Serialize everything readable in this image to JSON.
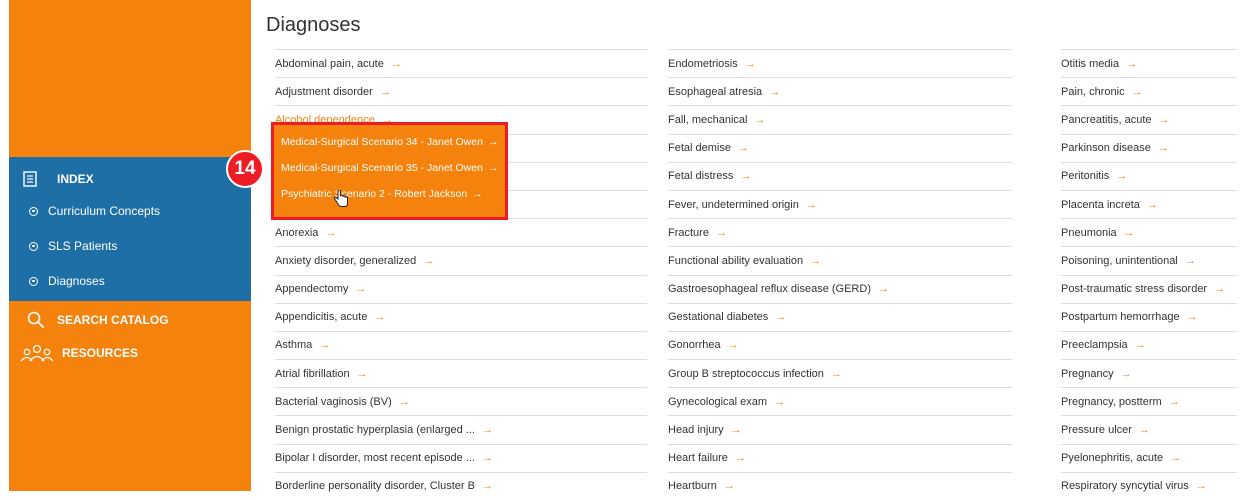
{
  "sidebar": {
    "index_label": "INDEX",
    "index_items": [
      "Curriculum Concepts",
      "SLS Patients",
      "Diagnoses"
    ],
    "search_label": "SEARCH CATALOG",
    "resources_label": "RESOURCES"
  },
  "page_title": "Diagnoses",
  "arrow": "→",
  "columns": [
    [
      "Abdominal pain, acute",
      "Adjustment disorder",
      "Alcohol dependence",
      "",
      "",
      "",
      "Anorexia",
      "Anxiety disorder, generalized",
      "Appendectomy",
      "Appendicitis, acute",
      "Asthma",
      "Atrial fibrillation",
      "Bacterial vaginosis (BV)",
      "Benign prostatic hyperplasia (enlarged ...",
      "Bipolar I disorder, most recent episode ...",
      "Borderline personality disorder, Cluster B"
    ],
    [
      "Endometriosis",
      "Esophageal atresia",
      "Fall, mechanical",
      "Fetal demise",
      "Fetal distress",
      "Fever, undetermined origin",
      "Fracture",
      "Functional ability evaluation",
      "Gastroesophageal reflux disease (GERD)",
      "Gestational diabetes",
      "Gonorrhea",
      "Group B streptococcus infection",
      "Gynecological exam",
      "Head injury",
      "Heart failure",
      "Heartburn"
    ],
    [
      "Otitis media",
      "Pain, chronic",
      "Pancreatitis, acute",
      "Parkinson disease",
      "Peritonitis",
      "Placenta increta",
      "Pneumonia",
      "Poisoning, unintentional",
      "Post-traumatic stress disorder",
      "Postpartum hemorrhage",
      "Preeclampsia",
      "Pregnancy",
      "Pregnancy, postterm",
      "Pressure ulcer",
      "Pyelonephritis, acute",
      "Respiratory syncytial virus"
    ]
  ],
  "popup": {
    "items": [
      "Medical-Surgical Scenario 34 - Janet Owen",
      "Medical-Surgical Scenario 35 - Janet Owen",
      "Psychiatric Scenario 2 - Robert Jackson"
    ]
  },
  "step_badge": "14",
  "colors": {
    "orange": "#f5820d",
    "blue": "#1e6fa5",
    "red": "#ee1c24"
  }
}
